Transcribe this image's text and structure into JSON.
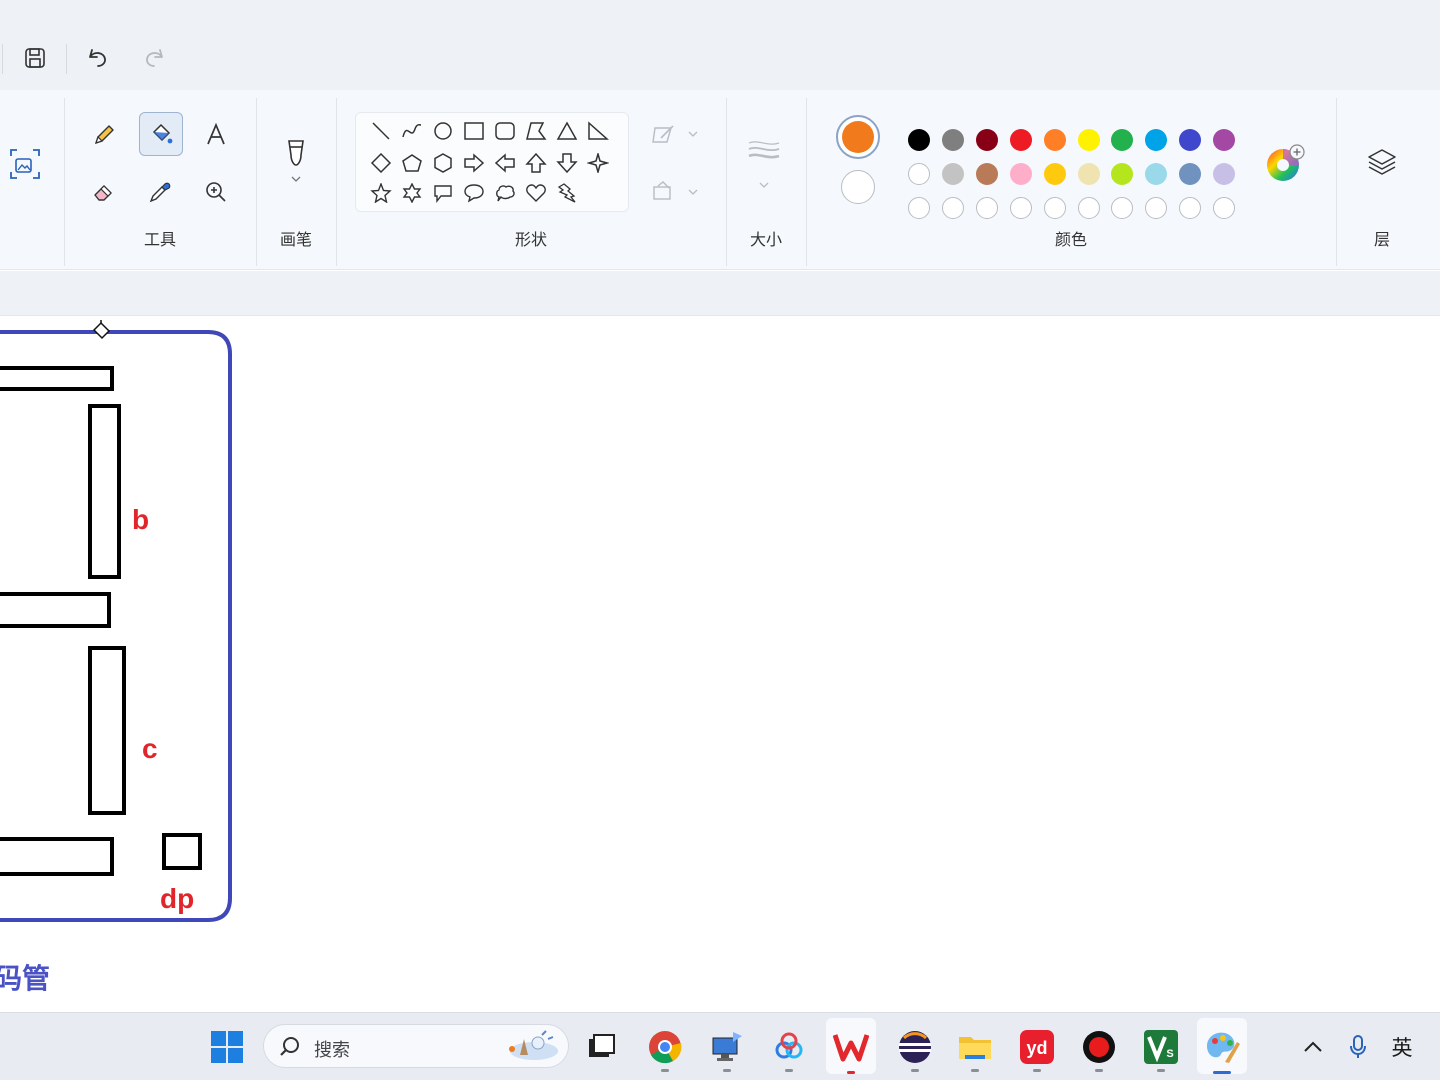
{
  "quickbar": {
    "save": "save-icon",
    "undo": "undo-icon",
    "redo": "redo-icon"
  },
  "ribbon": {
    "groups": {
      "tools": "工具",
      "brushes": "画笔",
      "shapes": "形状",
      "size": "大小",
      "colors": "颜色",
      "layers": "层"
    },
    "tools": [
      "pencil-icon",
      "fill-icon",
      "text-icon",
      "eraser-icon",
      "color-picker-icon",
      "magnifier-icon"
    ],
    "selected_tool": "fill-icon",
    "primary_color": "#f07a1c",
    "secondary_color": "#ffffff",
    "palette_row1": [
      "#000000",
      "#7f7f7f",
      "#880015",
      "#ed1c24",
      "#ff7f27",
      "#fff200",
      "#22b14c",
      "#00a2e8",
      "#3f48cc",
      "#a349a4"
    ],
    "palette_row2": [
      "#ffffff",
      "#c3c3c3",
      "#b97a57",
      "#ffaec9",
      "#ffc90e",
      "#efe4b0",
      "#b5e61d",
      "#99d9ea",
      "#7092be",
      "#c8bfe7"
    ]
  },
  "canvas": {
    "labels": {
      "b": "b",
      "c": "c",
      "dp": "dp",
      "caption": "码管"
    },
    "frame_color": "#4047b8",
    "label_color": "#e0262b",
    "caption_color": "#4a52c4"
  },
  "taskbar": {
    "search_placeholder": "搜索",
    "apps": [
      "windows-start-icon",
      "task-view-icon",
      "chrome-icon",
      "remote-desktop-icon",
      "baidu-netdisk-icon",
      "wps-icon",
      "eclipse-icon",
      "file-explorer-icon",
      "youdao-icon",
      "obs-icon",
      "vivado-icon",
      "paint-icon"
    ],
    "ime": "英"
  }
}
